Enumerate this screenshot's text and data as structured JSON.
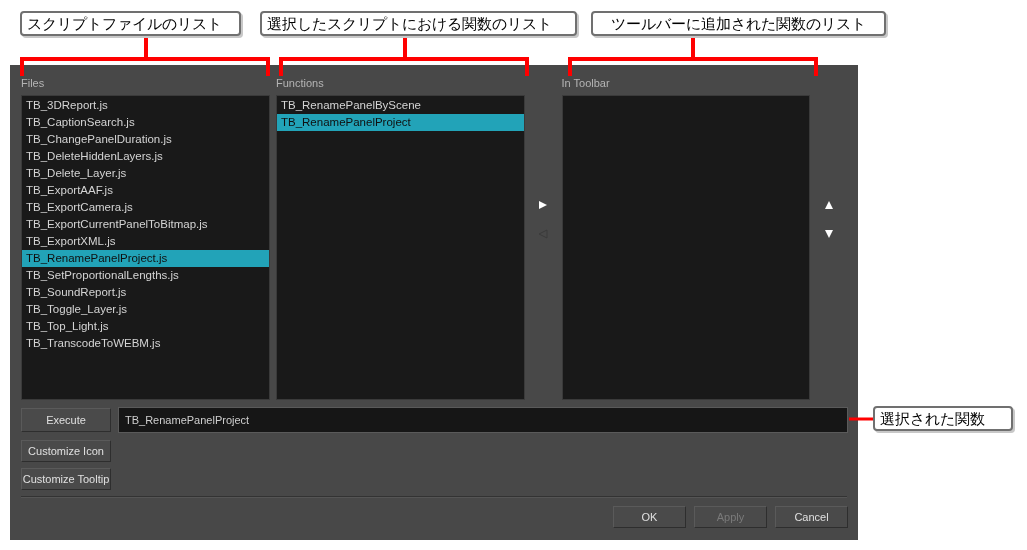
{
  "callouts": [
    {
      "text": "スクリプトファイルのリスト"
    },
    {
      "text": "選択したスクリプトにおける関数のリスト"
    },
    {
      "text": "ツールバーに追加された関数のリスト"
    },
    {
      "text": "選択された関数"
    }
  ],
  "dialog": {
    "lists": [
      {
        "label": "Files",
        "items": [
          {
            "text": "TB_3DReport.js",
            "selected": false
          },
          {
            "text": "TB_CaptionSearch.js",
            "selected": false
          },
          {
            "text": "TB_ChangePanelDuration.js",
            "selected": false
          },
          {
            "text": "TB_DeleteHiddenLayers.js",
            "selected": false
          },
          {
            "text": "TB_Delete_Layer.js",
            "selected": false
          },
          {
            "text": "TB_ExportAAF.js",
            "selected": false
          },
          {
            "text": "TB_ExportCamera.js",
            "selected": false
          },
          {
            "text": "TB_ExportCurrentPanelToBitmap.js",
            "selected": false
          },
          {
            "text": "TB_ExportXML.js",
            "selected": false
          },
          {
            "text": "TB_RenamePanelProject.js",
            "selected": true
          },
          {
            "text": "TB_SetProportionalLengths.js",
            "selected": false
          },
          {
            "text": "TB_SoundReport.js",
            "selected": false
          },
          {
            "text": "TB_Toggle_Layer.js",
            "selected": false
          },
          {
            "text": "TB_Top_Light.js",
            "selected": false
          },
          {
            "text": "TB_TranscodeToWEBM.js",
            "selected": false
          }
        ]
      },
      {
        "label": "Functions",
        "items": [
          {
            "text": "TB_RenamePanelByScene",
            "selected": false
          },
          {
            "text": "TB_RenamePanelProject",
            "selected": true
          }
        ]
      },
      {
        "label": "In Toolbar"
      }
    ],
    "move_buttons": [
      {
        "kind": "add",
        "disabled": false
      },
      {
        "kind": "remove",
        "disabled": true
      }
    ],
    "order_buttons": [
      {
        "kind": "up",
        "disabled": false
      },
      {
        "kind": "down",
        "disabled": false
      }
    ],
    "execute_button": "Execute",
    "function_field": {
      "value": "TB_RenamePanelProject"
    },
    "customize_buttons": [
      "Customize Icon",
      "Customize Tooltip"
    ],
    "buttons": [
      {
        "label": "OK",
        "disabled": false
      },
      {
        "label": "Apply",
        "disabled": true
      },
      {
        "label": "Cancel",
        "disabled": false
      }
    ]
  }
}
